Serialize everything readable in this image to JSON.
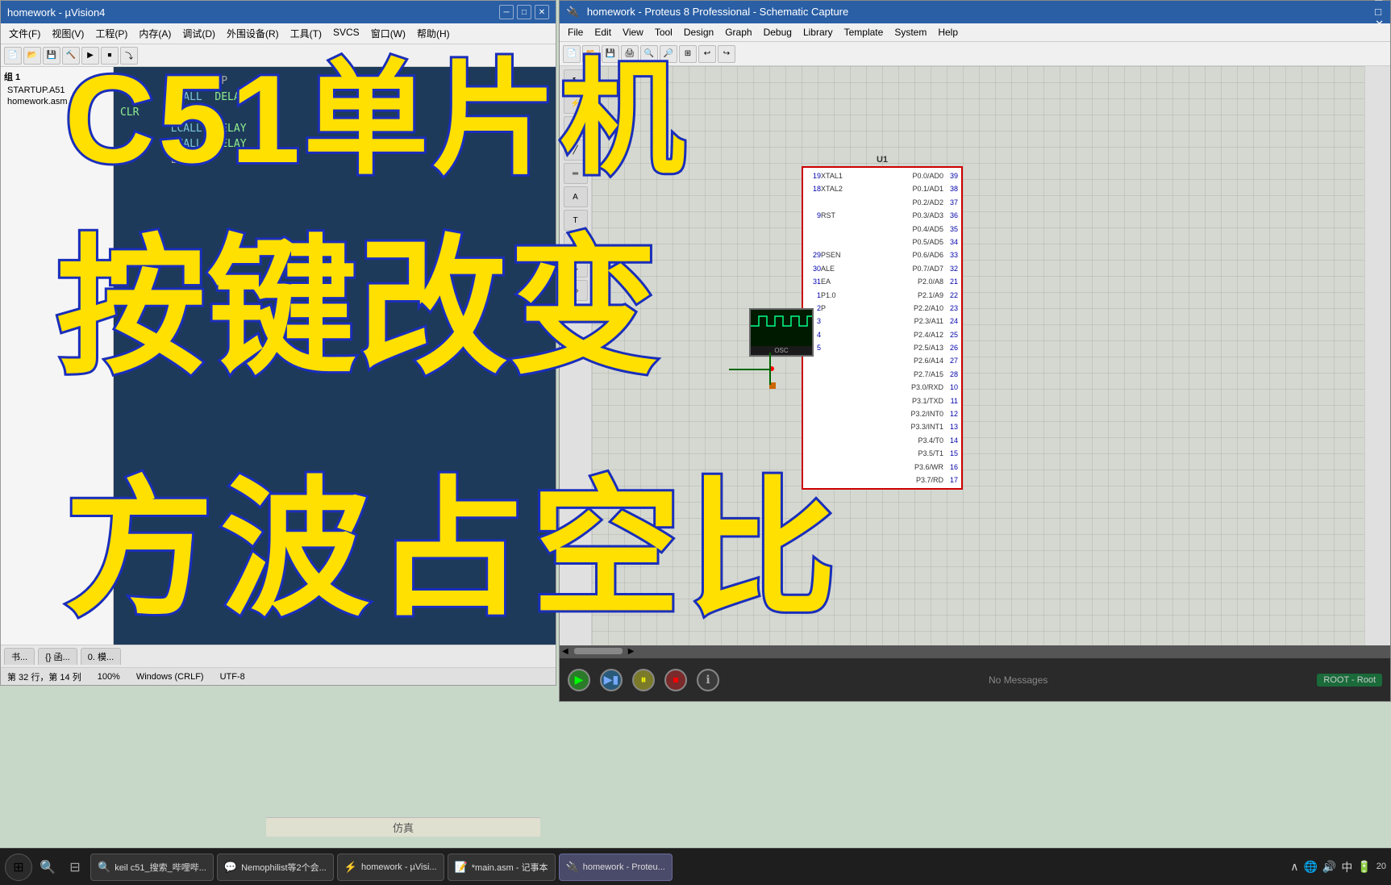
{
  "app": {
    "uv_title": "homework - µVision4",
    "proteus_title": "homework - Proteus 8 Professional - Schematic Capture"
  },
  "uv": {
    "title": "homework - µVision4",
    "menu": [
      "文件(F)",
      "视图(V)",
      "工程(P)",
      "内存(A)",
      "调试(D)",
      "外围设备(R)",
      "工具(T)",
      "SVCS",
      "窗口(W)",
      "帮助(H)"
    ],
    "sidebar": {
      "group": "组 1",
      "items": [
        "STARTUP.A51",
        "homework.asm"
      ]
    },
    "editor_tab": "*main.asm - 记事本",
    "code_lines": [
      "        ORG    0P",
      "        LCALL  DELAY",
      "CLR    P1.0",
      "        LCALL  DELAY",
      "        LCALL  DELAY",
      "        L"
    ],
    "statusbar": {
      "row_col": "第 32 行，第 14 列",
      "zoom": "100%",
      "line_ending": "Windows (CRLF)",
      "encoding": "UTF-8"
    },
    "bottom_tabs": [
      "书...",
      "{} 函...",
      "0. 模..."
    ]
  },
  "proteus": {
    "title": "homework - Proteus 8 Professional - Schematic Capture",
    "menu": [
      "File",
      "Edit",
      "View",
      "Tool",
      "Design",
      "Graph",
      "Debug",
      "Library",
      "Template",
      "System",
      "Help"
    ],
    "ic": {
      "label": "U1",
      "pins_left": [
        {
          "num": "19",
          "name": "XTAL1"
        },
        {
          "num": "18",
          "name": "XTAL2"
        },
        {
          "num": "9",
          "name": "RST"
        },
        {
          "num": "29",
          "name": "PSEN"
        },
        {
          "num": "30",
          "name": "ALE"
        },
        {
          "num": "31",
          "name": "EA"
        },
        {
          "num": "1",
          "name": "P1.0"
        },
        {
          "num": "2",
          "name": "P"
        },
        {
          "num": "3",
          "name": ""
        },
        {
          "num": "4",
          "name": ""
        },
        {
          "num": "5",
          "name": ""
        }
      ],
      "pins_right": [
        {
          "num": "39",
          "name": "P0.0/AD0"
        },
        {
          "num": "38",
          "name": "P0.1/AD1"
        },
        {
          "num": "37",
          "name": "P0.2/AD2"
        },
        {
          "num": "36",
          "name": "P0.3/AD3"
        },
        {
          "num": "35",
          "name": "P0.4/AD5"
        },
        {
          "num": "34",
          "name": "P0.5/AD5"
        },
        {
          "num": "33",
          "name": "P0.6/AD6"
        },
        {
          "num": "32",
          "name": "P0.7/AD7"
        },
        {
          "num": "21",
          "name": "P2.0/A8"
        },
        {
          "num": "22",
          "name": "P2.1/A9"
        },
        {
          "num": "23",
          "name": "P2.2/A10"
        },
        {
          "num": "24",
          "name": "P2.3/A11"
        },
        {
          "num": "25",
          "name": "P2.4/A12"
        },
        {
          "num": "26",
          "name": "P2.5/A13"
        },
        {
          "num": "27",
          "name": "P2.6/A14"
        },
        {
          "num": "28",
          "name": "P2.7/A15"
        },
        {
          "num": "10",
          "name": "P3.0/RXD"
        },
        {
          "num": "11",
          "name": "P3.1/TXD"
        },
        {
          "num": "12",
          "name": "P3.2/INT0"
        },
        {
          "num": "13",
          "name": "P3.3/INT1"
        },
        {
          "num": "14",
          "name": "P3.4/T0"
        },
        {
          "num": "15",
          "name": "P3.5/T1"
        },
        {
          "num": "16",
          "name": "P3.6/WR"
        },
        {
          "num": "17",
          "name": "P3.7/RD"
        }
      ]
    },
    "simulation": {
      "no_messages": "No Messages",
      "status": "ROOT - Root"
    },
    "sim_label": "仿真"
  },
  "overlay": {
    "title1": "C51单片机",
    "title2": "按键改变",
    "title3": "方波占空比"
  },
  "taskbar": {
    "apps": [
      {
        "label": "keil c51_搜索_哔哩哔...",
        "icon": "🔍",
        "active": false
      },
      {
        "label": "Nemophilist等2个会...",
        "icon": "💬",
        "active": false
      },
      {
        "label": "homework - µVisi...",
        "icon": "⚡",
        "active": false
      },
      {
        "label": "*main.asm - 记事本",
        "icon": "📝",
        "active": false
      },
      {
        "label": "homework - Proteu...",
        "icon": "🔌",
        "active": true
      }
    ],
    "tray": "🔊 📶 🔋 中",
    "time": "20"
  }
}
